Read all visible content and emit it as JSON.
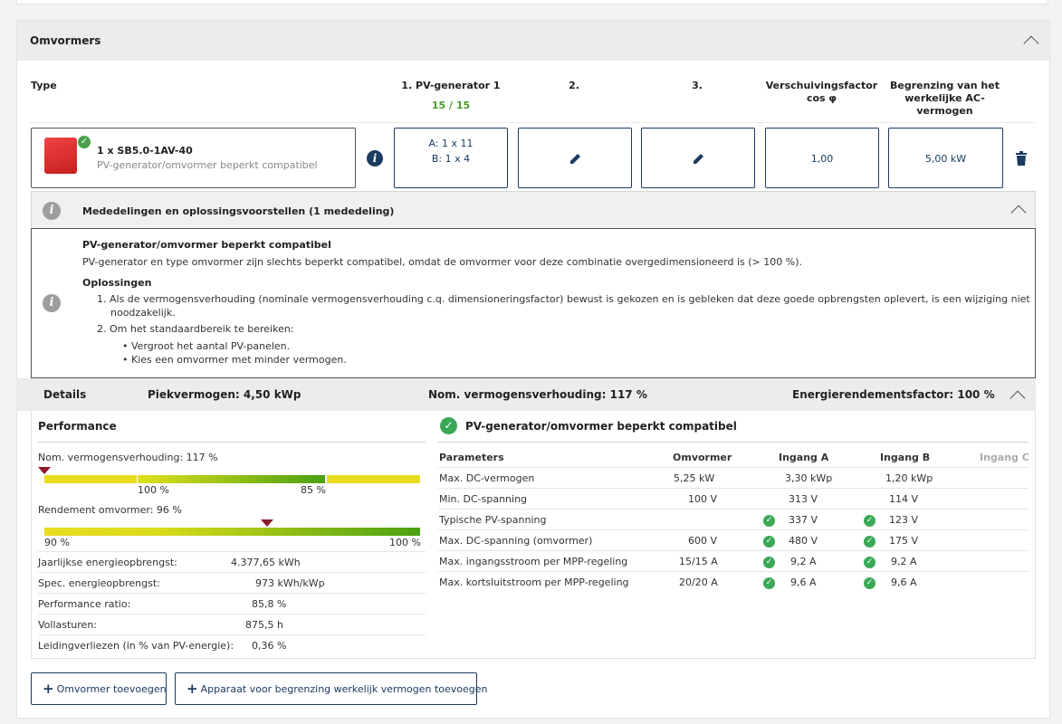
{
  "section": {
    "title": "Omvormers"
  },
  "columns": {
    "type": "Type",
    "pv1": "1. PV-generator 1",
    "pv1_count": "15 / 15",
    "pv2": "2.",
    "pv3": "3.",
    "cos_line1": "Verschuivingsfactor",
    "cos_line2": "cos φ",
    "ac_line1": "Begrenzing van het",
    "ac_line2": "werkelijke AC-",
    "ac_line3": "vermogen"
  },
  "inverter": {
    "name": "1 x SB5.0-1AV-40",
    "status": "PV-generator/omvormer beperkt compatibel",
    "string_a": "A: 1 x 11",
    "string_b": "B: 1 x 4",
    "cos_phi": "1,00",
    "ac_limit": "5,00 kW"
  },
  "messages": {
    "header": "Mededelingen en oplossingsvoorstellen (1 mededeling)",
    "title": "PV-generator/omvormer beperkt compatibel",
    "text": "PV-generator en type omvormer zijn slechts beperkt compatibel, omdat de omvormer voor deze combinatie overgedimensioneerd is (> 100 %).",
    "solutions_title": "Oplossingen",
    "solution1_line1": "1.  Als de vermogensverhouding (nominale vermogensverhouding c.q. dimensioneringsfactor) bewust is gekozen en is gebleken dat deze goede opbrengsten oplevert, is een wijziging niet",
    "solution1_line2": "noodzakelijk.",
    "solution2": "2.  Om het standaardbereik te bereiken:",
    "bullet1": "•  Vergroot het aantal PV-panelen.",
    "bullet2": "•  Kies een omvormer met minder vermogen."
  },
  "details": {
    "label": "Details",
    "peak_power": "Piekvermogen: 4,50 kWp",
    "nom_ratio": "Nom. vermogensverhouding: 117 %",
    "energy_factor": "Energierendementsfactor: 100 %"
  },
  "performance": {
    "title": "Performance",
    "ratio_label": "Nom. vermogensverhouding: 117 %",
    "ratio_value": 117,
    "ratio_tick1": "100 %",
    "ratio_tick2": "85 %",
    "eff_label": "Rendement omvormer: 96 %",
    "eff_value": 96,
    "eff_tick1": "90 %",
    "eff_tick2": "100 %",
    "stats": [
      {
        "label": "Jaarlijkse energieopbrengst:",
        "value": "4.377,65 kWh"
      },
      {
        "label": "Spec. energieopbrengst:",
        "value": "973 kWh/kWp"
      },
      {
        "label": "Performance ratio:",
        "value": "85,8 %"
      },
      {
        "label": "Vollasturen:",
        "value": "875,5 h"
      },
      {
        "label": "Leidingverliezen (in % van PV-energie):",
        "value": "0,36 %"
      }
    ]
  },
  "compat": {
    "title": "PV-generator/omvormer beperkt compatibel",
    "headers": {
      "param": "Parameters",
      "inv": "Omvormer",
      "a": "Ingang A",
      "b": "Ingang B",
      "c": "Ingang C"
    },
    "rows": [
      {
        "param": "Max. DC-vermogen",
        "inv": "5,25 kW",
        "a": "3,30 kWp",
        "b": "1,20 kWp",
        "check": false
      },
      {
        "param": "Min. DC-spanning",
        "inv": "100 V",
        "a": "313 V",
        "b": "114 V",
        "check": false
      },
      {
        "param": "Typische PV-spanning",
        "inv": "",
        "a": "337 V",
        "b": "123 V",
        "check": true
      },
      {
        "param": "Max. DC-spanning (omvormer)",
        "inv": "600 V",
        "a": "480 V",
        "b": "175 V",
        "check": true
      },
      {
        "param": "Max. ingangsstroom per MPP-regeling",
        "inv": "15/15 A",
        "a": "9,2 A",
        "b": "9,2 A",
        "check": true
      },
      {
        "param": "Max. kortsluitstroom per MPP-regeling",
        "inv": "20/20 A",
        "a": "9,6 A",
        "b": "9,6 A",
        "check": true
      }
    ]
  },
  "buttons": {
    "add_inverter": "Omvormer toevoegen",
    "add_device": "Apparaat voor begrenzing werkelijk vermogen toevoegen"
  }
}
